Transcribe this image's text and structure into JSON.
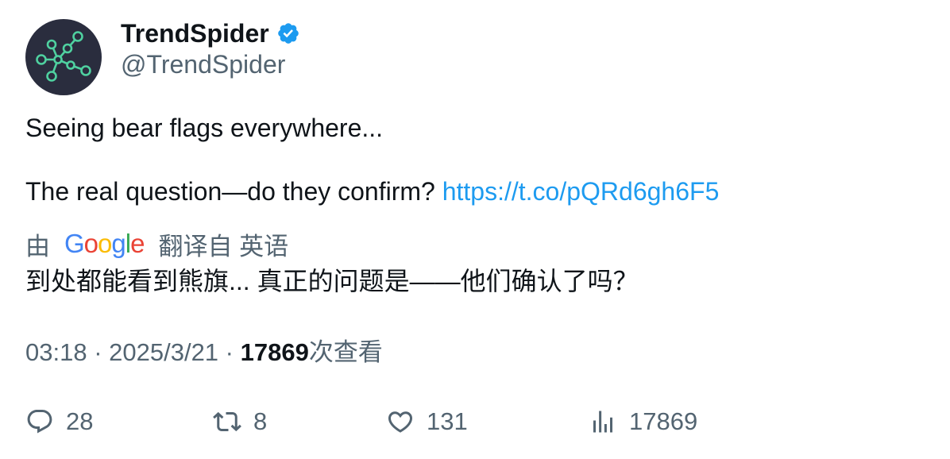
{
  "author": {
    "display_name": "TrendSpider",
    "handle": "@TrendSpider",
    "verified": true,
    "verified_color": "#1d9bf0",
    "avatar_icon": "network-nodes-logo"
  },
  "tweet": {
    "line1": "Seeing bear flags everywhere...",
    "line2_text": "The real question—do they confirm? ",
    "link": "https://t.co/pQRd6gh6F5"
  },
  "translation": {
    "prefix": "由",
    "provider_letters": [
      "G",
      "o",
      "o",
      "g",
      "l",
      "e"
    ],
    "suffix": "翻译自 英语",
    "text": "到处都能看到熊旗... 真正的问题是——他们确认了吗？"
  },
  "meta": {
    "time": "03:18",
    "separator": " · ",
    "date": "2025/3/21",
    "views_count": "17869",
    "views_label": "次查看"
  },
  "actions": {
    "replies": "28",
    "retweets": "8",
    "likes": "131",
    "views": "17869"
  },
  "colors": {
    "text": "#0f1419",
    "secondary": "#536471",
    "link": "#1d9bf0",
    "avatar_bg": "#2a2d3e",
    "avatar_nodes": "#4fd1a0"
  }
}
